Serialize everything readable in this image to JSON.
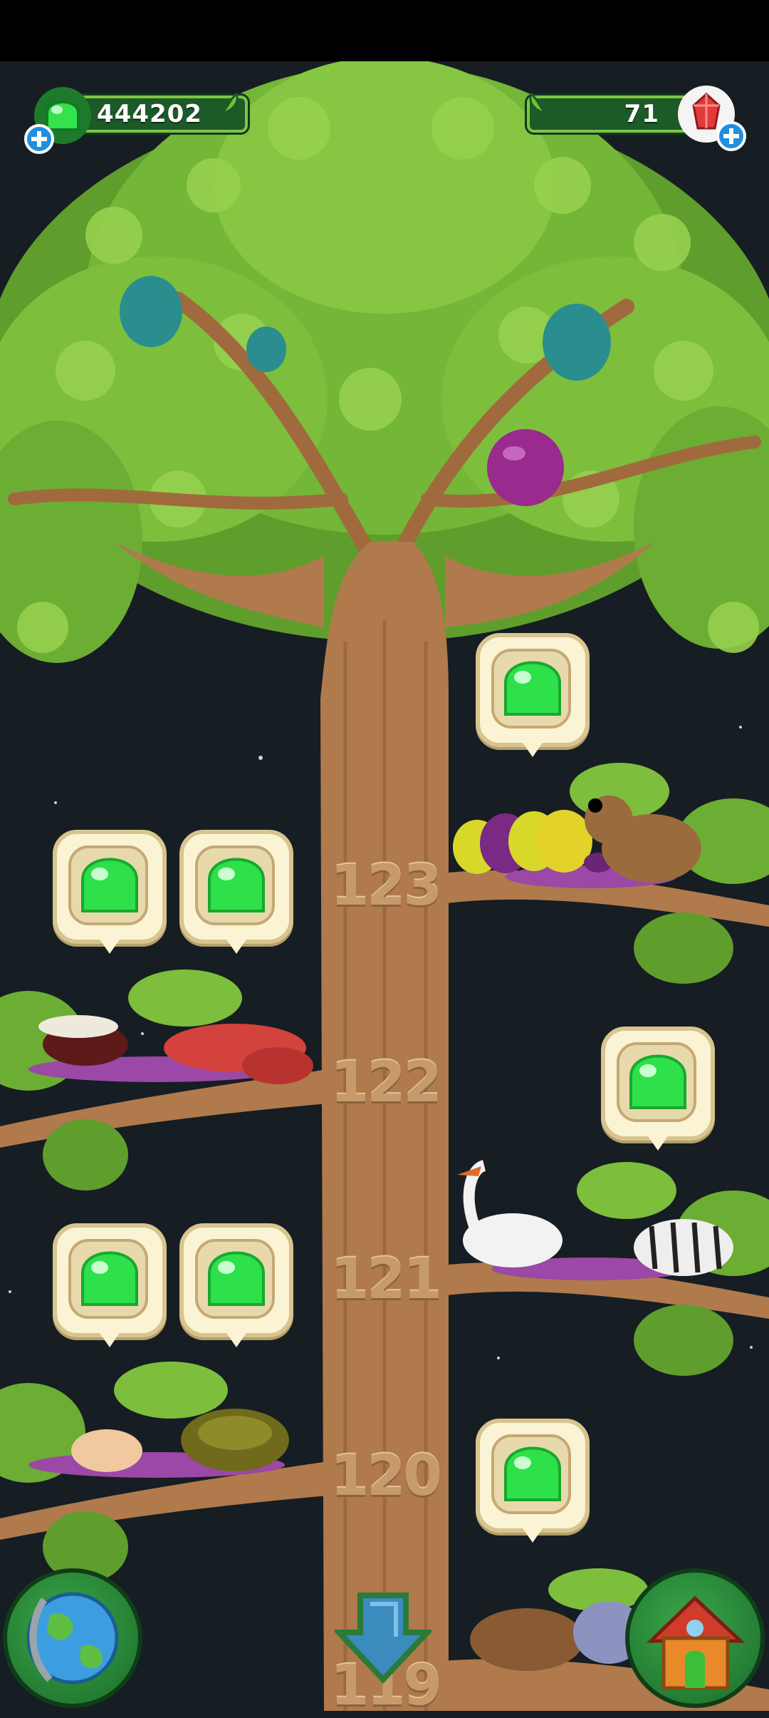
{
  "hud": {
    "slime_count": "444202",
    "gem_count": "71"
  },
  "levels": [
    {
      "number": "123"
    },
    {
      "number": "122"
    },
    {
      "number": "121"
    },
    {
      "number": "120"
    },
    {
      "number": "119"
    }
  ],
  "colors": {
    "background": "#161d23",
    "bark": "#b07a4c",
    "leaf": "#7dbe3c",
    "slime": "#2ee04a",
    "hud_bar": "#1c5a28"
  },
  "icons": {
    "slime": "slime-drop-icon",
    "gem": "red-gem-icon",
    "add": "plus-icon",
    "world": "globe-icon",
    "home": "house-icon",
    "scroll_down": "down-arrow-icon"
  }
}
